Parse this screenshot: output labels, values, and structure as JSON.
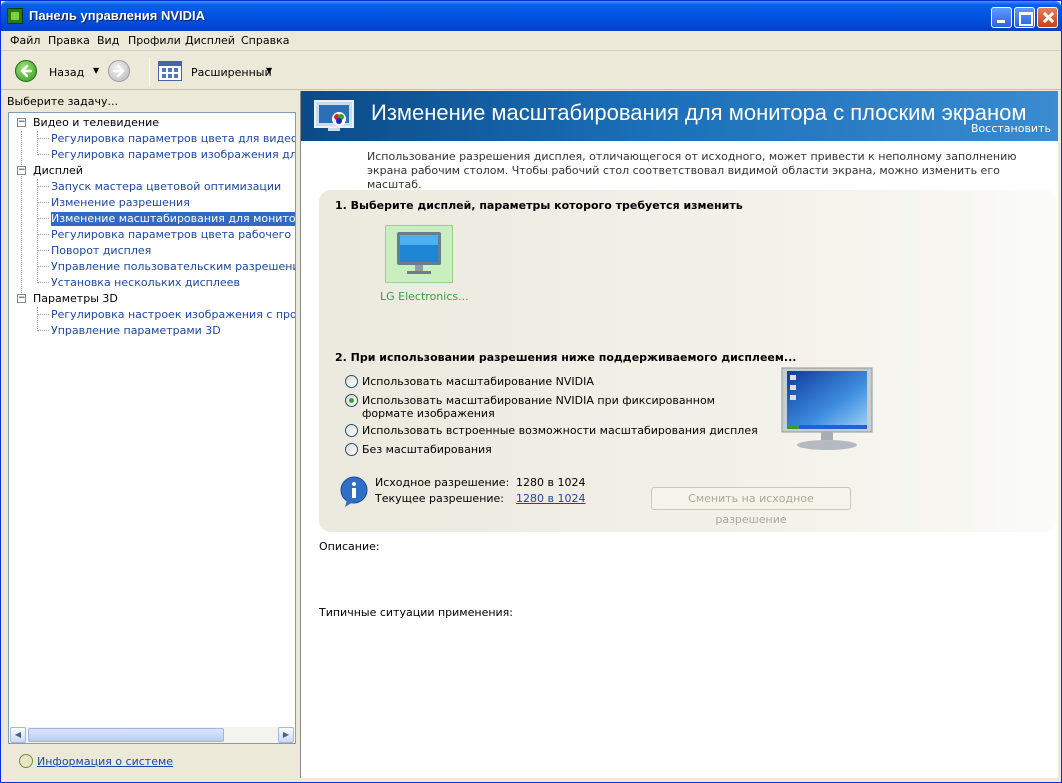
{
  "window": {
    "title": "Панель управления NVIDIA"
  },
  "menu": [
    {
      "label": "Файл"
    },
    {
      "label": "Правка"
    },
    {
      "label": "Вид"
    },
    {
      "label": "Профили"
    },
    {
      "label": "Дисплей"
    },
    {
      "label": "Справка"
    }
  ],
  "toolbar": {
    "back_label": "Назад",
    "view_label": "Расширенный"
  },
  "left": {
    "header": "Выберите задачу...",
    "tree": [
      {
        "label": "Видео и телевидение",
        "children": [
          {
            "label": "Регулировка параметров цвета для видео"
          },
          {
            "label": "Регулировка параметров изображения для видео"
          }
        ]
      },
      {
        "label": "Дисплей",
        "children": [
          {
            "label": "Запуск мастера цветовой оптимизации"
          },
          {
            "label": "Изменение разрешения"
          },
          {
            "label": "Изменение масштабирования для монитора с плоским экраном"
          },
          {
            "label": "Регулировка параметров цвета рабочего стола"
          },
          {
            "label": "Поворот дисплея"
          },
          {
            "label": "Управление пользовательским разрешением"
          },
          {
            "label": "Установка нескольких дисплеев"
          }
        ]
      },
      {
        "label": "Параметры 3D",
        "children": [
          {
            "label": "Регулировка настроек изображения с просмотром"
          },
          {
            "label": "Управление параметрами 3D"
          }
        ]
      }
    ],
    "sysinfo_link": "Информация о системе"
  },
  "right": {
    "banner_title": "Изменение масштабирования для монитора с плоским экраном",
    "restore_link": "Восстановить",
    "intro": "Использование разрешения дисплея, отличающегося от исходного, может привести к неполному заполнению экрана рабочим столом. Чтобы рабочий стол соответствовал видимой области экрана, можно изменить его масштаб.",
    "section1_title": "1. Выберите дисплей, параметры которого требуется изменить",
    "display_name": "LG Electronics...",
    "section2_title": "2. При использовании разрешения ниже поддерживаемого дисплеем...",
    "options": [
      {
        "label": "Использовать масштабирование NVIDIA",
        "selected": false
      },
      {
        "label": "Использовать масштабирование NVIDIA при фиксированном формате изображения",
        "selected": true
      },
      {
        "label": "Использовать встроенные возможности масштабирования дисплея",
        "selected": false
      },
      {
        "label": "Без масштабирования",
        "selected": false
      }
    ],
    "native_res_label": "Исходное разрешение:",
    "native_res_value": "1280 в 1024",
    "current_res_label": "Текущее разрешение:",
    "current_res_value": "1280 в 1024",
    "revert_button": "Сменить на исходное разрешение",
    "description_label": "Описание:",
    "usage_label": "Типичные ситуации применения:"
  }
}
